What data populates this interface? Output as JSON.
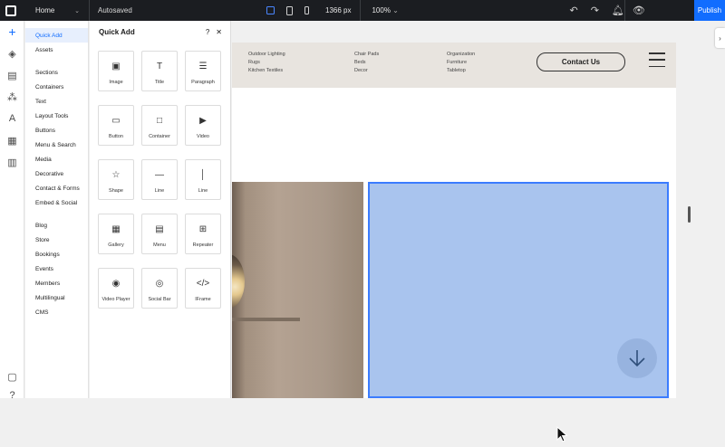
{
  "topbar": {
    "page_name": "Home",
    "autosaved": "Autosaved",
    "width_px": "1366 px",
    "zoom": "100%",
    "publish": "Publish"
  },
  "categories": {
    "group1": [
      "Quick Add",
      "Assets"
    ],
    "group2": [
      "Sections",
      "Containers",
      "Text",
      "Layout Tools",
      "Buttons",
      "Menu & Search",
      "Media",
      "Decorative",
      "Contact & Forms",
      "Embed & Social"
    ],
    "group3": [
      "Blog",
      "Store",
      "Bookings",
      "Events",
      "Members",
      "Multilingual",
      "CMS"
    ]
  },
  "quick_add": {
    "title": "Quick Add",
    "help": "?",
    "close": "✕",
    "tiles": [
      {
        "label": "Image",
        "icon": "image-icon",
        "glyph": "▣"
      },
      {
        "label": "Title",
        "icon": "title-icon",
        "glyph": "T"
      },
      {
        "label": "Paragraph",
        "icon": "paragraph-icon",
        "glyph": "☰"
      },
      {
        "label": "Button",
        "icon": "button-icon",
        "glyph": "▭"
      },
      {
        "label": "Container",
        "icon": "container-icon",
        "glyph": "□"
      },
      {
        "label": "Video",
        "icon": "video-icon",
        "glyph": "▶"
      },
      {
        "label": "Shape",
        "icon": "shape-icon",
        "glyph": "☆"
      },
      {
        "label": "Line",
        "icon": "horizontal-line-icon",
        "glyph": "—"
      },
      {
        "label": "Line",
        "icon": "vertical-line-icon",
        "glyph": "│"
      },
      {
        "label": "Gallery",
        "icon": "gallery-icon",
        "glyph": "▦"
      },
      {
        "label": "Menu",
        "icon": "menu-icon",
        "glyph": "▤"
      },
      {
        "label": "Repeater",
        "icon": "repeater-icon",
        "glyph": "⊞"
      },
      {
        "label": "Video Player",
        "icon": "video-player-icon",
        "glyph": "◉"
      },
      {
        "label": "Social Bar",
        "icon": "social-bar-icon",
        "glyph": "◎"
      },
      {
        "label": "IFrame",
        "icon": "iframe-icon",
        "glyph": "</>"
      }
    ]
  },
  "site": {
    "nav_col1": [
      "Outdoor Lighting",
      "Rugs",
      "Kitchen Textiles"
    ],
    "nav_col2": [
      "Chair Pads",
      "Beds",
      "Decor"
    ],
    "nav_col3": [
      "Organization",
      "Furniture",
      "Tabletop"
    ],
    "contact_button": "Contact Us"
  },
  "colors": {
    "accent": "#116dff",
    "topbar": "#1b1d21",
    "selection_box": "#a9c4ee",
    "header_bg": "#e8e4df"
  }
}
